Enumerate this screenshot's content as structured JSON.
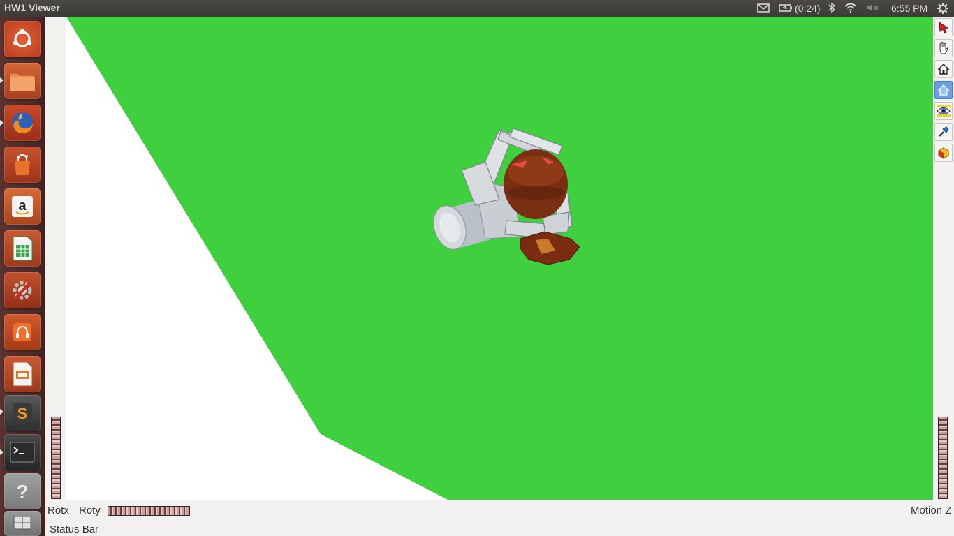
{
  "window": {
    "title": "HW1 Viewer"
  },
  "panel": {
    "battery_text": "(0:24)",
    "clock": "6:55 PM",
    "indicators": [
      "mail-icon",
      "battery-icon",
      "bluetooth-icon",
      "wifi-icon",
      "volume-muted-icon",
      "session-gear-icon"
    ]
  },
  "launcher": {
    "items": [
      {
        "name": "ubuntu-dash-icon"
      },
      {
        "name": "files-icon"
      },
      {
        "name": "firefox-icon"
      },
      {
        "name": "software-center-icon"
      },
      {
        "name": "amazon-icon"
      },
      {
        "name": "libreoffice-calc-icon"
      },
      {
        "name": "system-settings-icon"
      },
      {
        "name": "ubuntu-one-music-icon"
      },
      {
        "name": "libreoffice-impress-icon"
      },
      {
        "name": "sublime-text-icon"
      },
      {
        "name": "terminal-icon"
      },
      {
        "name": "help-icon"
      },
      {
        "name": "workspace-switcher-icon"
      }
    ]
  },
  "viewer": {
    "toolbar": [
      "select-arrow-icon",
      "hand-pan-icon",
      "home-icon",
      "set-home-icon",
      "view-all-eye-icon",
      "seek-icon",
      "projection-cube-icon"
    ],
    "active_tool": "set-home-icon",
    "thumbwheels": {
      "rotx_label": "Rotx",
      "roty_label": "Roty",
      "motion_label": "Motion Z"
    },
    "status": "Status Bar"
  },
  "colors": {
    "ground": "#3fcf3f",
    "background": "#ffffff",
    "object": "#6b2a10",
    "gripper": "#cfd3d6"
  }
}
